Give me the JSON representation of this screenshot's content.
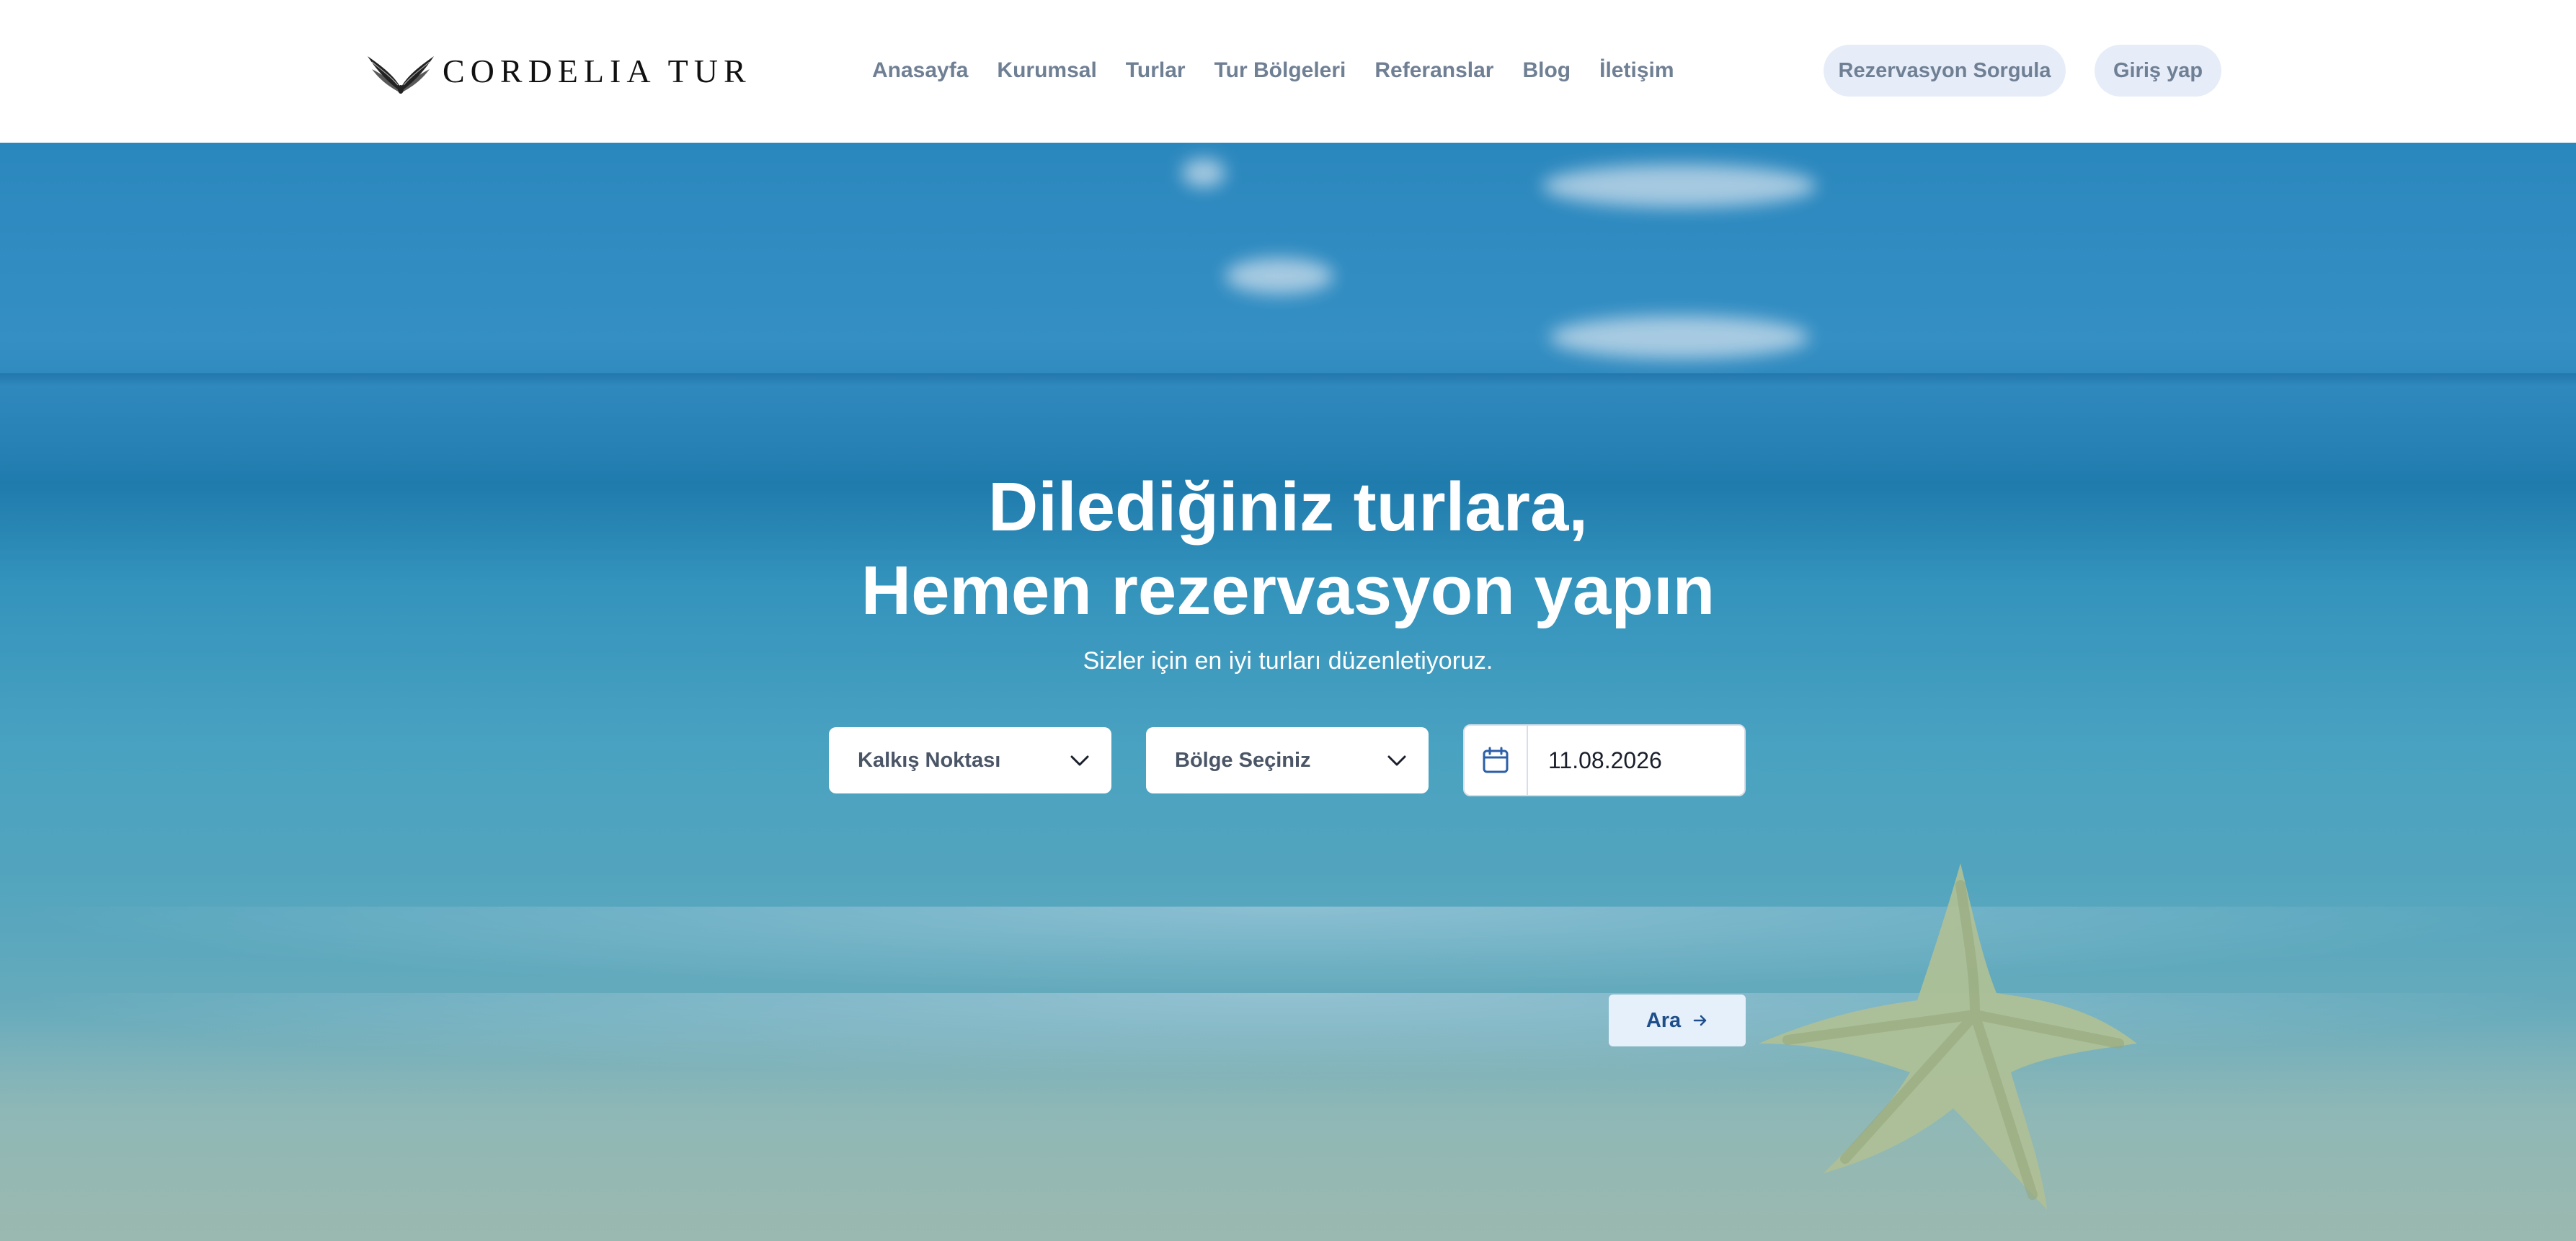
{
  "brand": {
    "name": "CORDELIA TUR",
    "logo_icon": "wings-logo-icon"
  },
  "nav": {
    "items": [
      {
        "label": "Anasayfa"
      },
      {
        "label": "Kurumsal"
      },
      {
        "label": "Turlar"
      },
      {
        "label": "Tur Bölgeleri"
      },
      {
        "label": "Referanslar"
      },
      {
        "label": "Blog"
      },
      {
        "label": "İletişim"
      }
    ]
  },
  "header_buttons": {
    "reservation_query": "Rezervasyon Sorgula",
    "login": "Giriş yap"
  },
  "hero": {
    "title_line1": "Dilediğiniz turlara,",
    "title_line2": "Hemen rezervasyon yapın",
    "subtitle": "Sizler için en iyi turları düzenletiyoruz."
  },
  "search": {
    "departure_placeholder": "Kalkış Noktası",
    "region_placeholder": "Bölge Seçiniz",
    "date_value": "11.08.2026",
    "button_label": "Ara",
    "button_icon": "arrow-right-icon",
    "calendar_icon": "calendar-icon",
    "dropdown_icon": "chevron-down-icon"
  },
  "colors": {
    "nav_text": "#6f7f94",
    "header_button_bg": "#e6edf8",
    "search_button_bg": "#e6f0fb",
    "search_button_text": "#1f4f8a",
    "hero_text": "#ffffff"
  }
}
